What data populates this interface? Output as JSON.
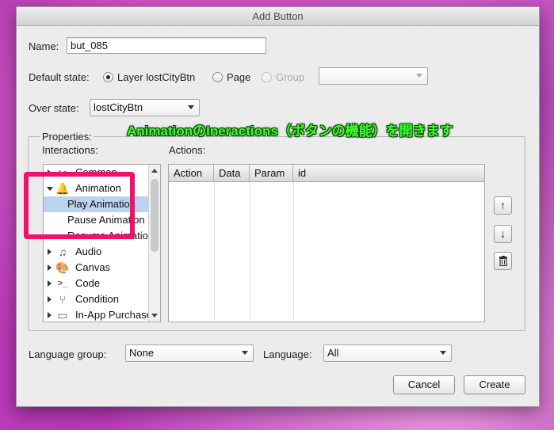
{
  "dialog": {
    "title": "Add Button"
  },
  "name": {
    "label": "Name:",
    "value": "but_085"
  },
  "default_state": {
    "label": "Default state:",
    "options": [
      "Layer lostCityBtn",
      "Page",
      "Group"
    ],
    "selected": "Layer lostCityBtn",
    "group_select_value": ""
  },
  "over_state": {
    "label": "Over state:",
    "value": "lostCityBtn"
  },
  "properties": {
    "label": "Properties:",
    "interactions_label": "Interactions:",
    "actions_label": "Actions:"
  },
  "tree": {
    "items": [
      {
        "label": "Common",
        "icon": "tools-icon",
        "expanded": false
      },
      {
        "label": "Animation",
        "icon": "bell-icon",
        "expanded": true
      },
      {
        "label": "Play Animation",
        "child": true,
        "selected": true
      },
      {
        "label": "Pause Animation",
        "child": true
      },
      {
        "label": "Resume Animation",
        "child": true
      },
      {
        "label": "Audio",
        "icon": "music-note-icon",
        "expanded": false
      },
      {
        "label": "Canvas",
        "icon": "palette-icon",
        "expanded": false
      },
      {
        "label": "Code",
        "icon": "terminal-icon",
        "expanded": false
      },
      {
        "label": "Condition",
        "icon": "condition-icon",
        "expanded": false
      },
      {
        "label": "In-App Purchase",
        "icon": "card-icon",
        "expanded": false
      }
    ]
  },
  "actions_table": {
    "columns": [
      "Action",
      "Data",
      "Param",
      "id"
    ]
  },
  "annotation": {
    "text": "AnimationのIneractions（ボタンの機能）を開きます"
  },
  "language_group": {
    "label": "Language group:",
    "value": "None"
  },
  "language": {
    "label": "Language:",
    "value": "All"
  },
  "buttons": {
    "cancel": "Cancel",
    "create": "Create"
  },
  "colors": {
    "highlight": "#f0116e",
    "annotation": "#3cff2a",
    "selection": "#bcd3ee"
  }
}
